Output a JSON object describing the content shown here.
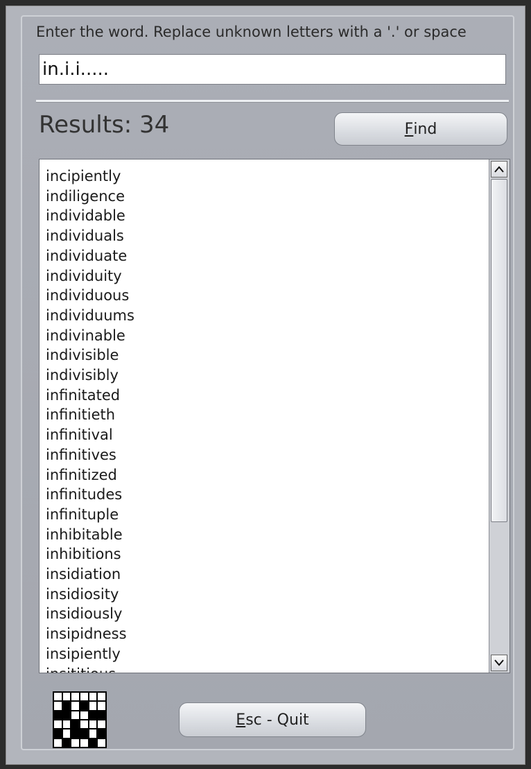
{
  "instructions": "Enter the word. Replace unknown letters with a '.' or space",
  "search": {
    "value": "in.i.i....."
  },
  "results": {
    "label": "Results: 34"
  },
  "find_button": {
    "accel": "F",
    "rest": "ind"
  },
  "quit_button": {
    "accel": "E",
    "rest": "sc - Quit"
  },
  "icons": {
    "scroll_up": "caret-up",
    "scroll_down": "caret-down",
    "logo": "crossword-grid"
  },
  "words": [
    "incipiently",
    "indiligence",
    "individable",
    "individuals",
    "individuate",
    "individuity",
    "individuous",
    "individuums",
    "indivinable",
    "indivisible",
    "indivisibly",
    "infinitated",
    "infinitieth",
    "infinitival",
    "infinitives",
    "infinitized",
    "infinitudes",
    "infinituple",
    "inhibitable",
    "inhibitions",
    "insidiation",
    "insidiosity",
    "insidiously",
    "insipidness",
    "insipiently",
    "insititious"
  ]
}
